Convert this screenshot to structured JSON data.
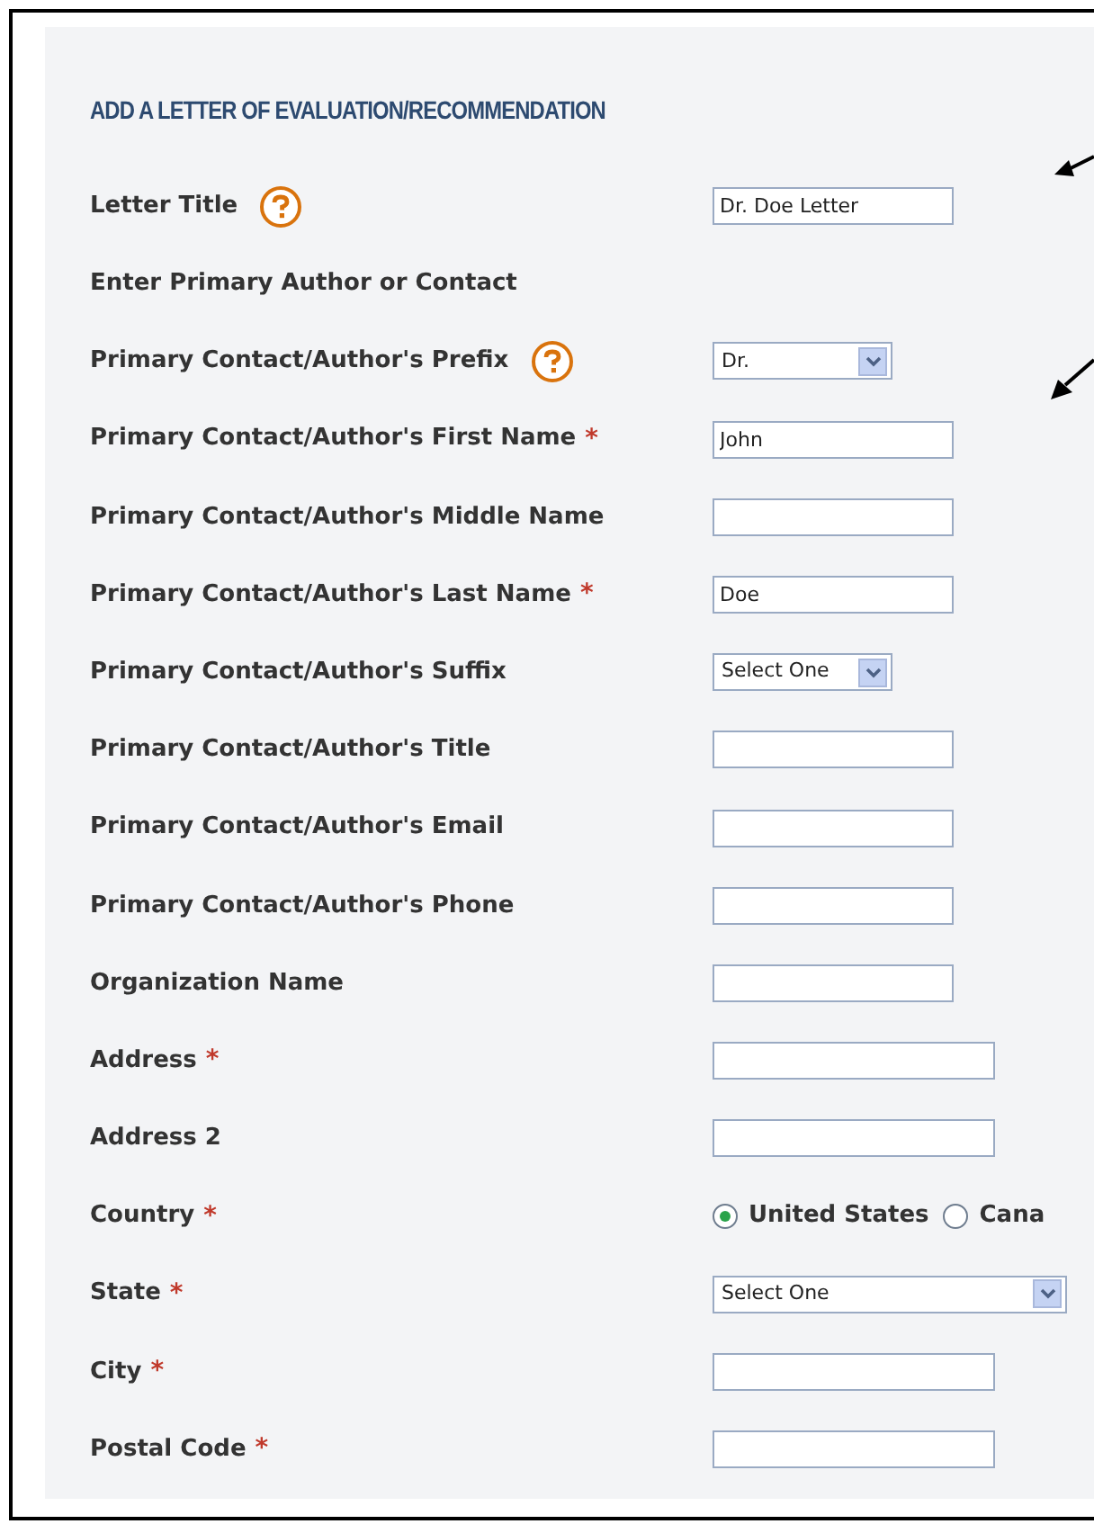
{
  "heading": "ADD A LETTER OF EVALUATION/RECOMMENDATION",
  "rows": [
    {
      "kind": "text",
      "label": "Letter Title",
      "help": true,
      "value": "Dr. Doe Letter",
      "wide": false
    },
    {
      "kind": "section",
      "label": "Enter Primary Author or Contact"
    },
    {
      "kind": "select",
      "label": "Primary Contact/Author's Prefix",
      "help": true,
      "value": "Dr.",
      "wide": false
    },
    {
      "kind": "text",
      "label": "Primary Contact/Author's First Name",
      "help": false,
      "required_mark": "*",
      "value": "John",
      "wide": false
    },
    {
      "kind": "text",
      "label": "Primary Contact/Author's Middle Name",
      "help": false,
      "wide": false
    },
    {
      "kind": "text",
      "label": "Primary Contact/Author's Last Name",
      "help": false,
      "required_mark": "*",
      "value": "Doe",
      "wide": false
    },
    {
      "kind": "select",
      "label": "Primary Contact/Author's Suffix",
      "help": false,
      "value": "Select One",
      "wide": false
    },
    {
      "kind": "text",
      "label": "Primary Contact/Author's Title",
      "help": false,
      "wide": false
    },
    {
      "kind": "text",
      "label": "Primary Contact/Author's Email",
      "help": false,
      "wide": false
    },
    {
      "kind": "text",
      "label": "Primary Contact/Author's Phone",
      "help": false,
      "wide": false
    },
    {
      "kind": "text",
      "label": "Organization Name",
      "help": false,
      "wide": false
    },
    {
      "kind": "text",
      "label": "Address",
      "help": false,
      "required_mark": "*",
      "wide": true
    },
    {
      "kind": "text",
      "label": "Address 2",
      "help": false,
      "wide": true
    },
    {
      "kind": "radio",
      "label": "Country",
      "help": false,
      "required_mark": "*",
      "options": [
        {
          "label": "United States",
          "selected": true
        },
        {
          "label": "Cana",
          "selected": false
        }
      ]
    },
    {
      "kind": "select",
      "label": "State",
      "help": false,
      "required_mark": "*",
      "value": "Select One",
      "wide": true
    },
    {
      "kind": "text",
      "label": "City",
      "help": false,
      "required_mark": "*",
      "wide": true
    },
    {
      "kind": "text",
      "label": "Postal Code",
      "help": false,
      "required_mark": "*",
      "wide": true
    }
  ]
}
